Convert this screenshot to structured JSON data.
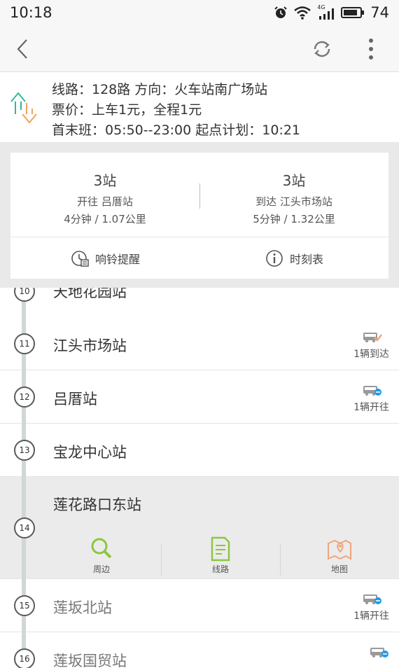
{
  "status_bar": {
    "time": "10:18",
    "network": "4G",
    "battery": "74"
  },
  "top_bar": {
    "icons": [
      "back-arrow-icon",
      "refresh-icon",
      "more-icon"
    ]
  },
  "route_info": {
    "line1": "线路：128路   方向：火车站南广场站",
    "line2": "票价：上车1元，全程1元",
    "line3": "首末班：05:50--23:00   起点计划：10:21"
  },
  "summary": {
    "left": {
      "count": "3站",
      "label": "开往 吕厝站",
      "detail": "4分钟 / 1.07公里"
    },
    "right": {
      "count": "3站",
      "label": "到达 江头市场站",
      "detail": "5分钟 / 1.32公里"
    },
    "alarm_label": "响铃提醒",
    "schedule_label": "时刻表"
  },
  "stops": [
    {
      "num": "10",
      "name": "天地花园站"
    },
    {
      "num": "11",
      "name": "江头市场站",
      "bus": "1辆到达"
    },
    {
      "num": "12",
      "name": "吕厝站",
      "bus": "1辆开往"
    },
    {
      "num": "13",
      "name": "宝龙中心站"
    },
    {
      "num": "14",
      "name": "莲花路口东站"
    },
    {
      "num": "15",
      "name": "莲坂北站",
      "bus": "1辆开往"
    },
    {
      "num": "16",
      "name": "莲坂国贸站"
    }
  ],
  "selected_actions": {
    "nearby": "周边",
    "route": "线路",
    "map": "地图"
  },
  "colors": {
    "accent_green": "#2fb9a0",
    "accent_orange": "#f3a15a",
    "icon_green": "#8cc63f",
    "icon_orange": "#f0a57c",
    "bus_blue": "#1e9be9"
  }
}
